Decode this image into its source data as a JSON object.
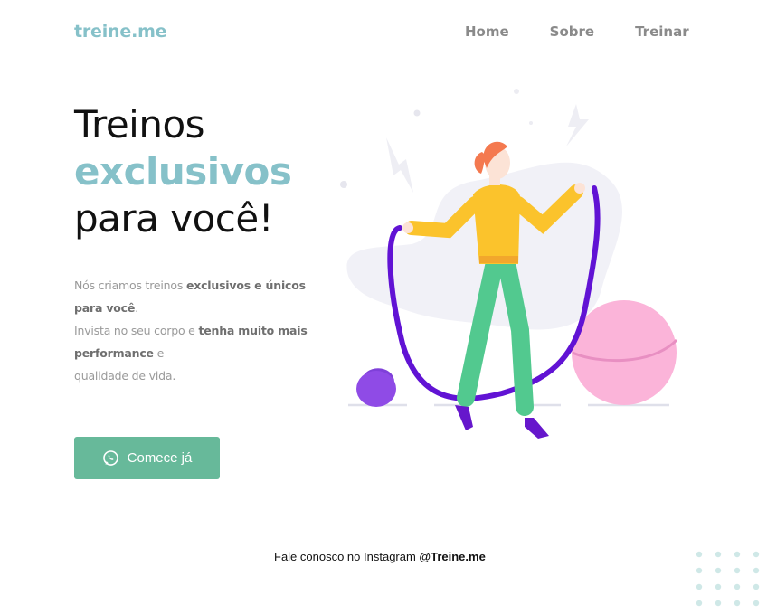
{
  "header": {
    "logo": "treine.me",
    "nav": [
      {
        "label": "Home"
      },
      {
        "label": "Sobre"
      },
      {
        "label": "Treinar"
      }
    ]
  },
  "hero": {
    "title_line1": "Treinos",
    "title_line2": "exclusivos",
    "title_line3": "para você!",
    "description": {
      "p1_a": "Nós criamos treinos ",
      "p1_b": "exclusivos e únicos para você",
      "p1_c": ".",
      "p2_a": "Invista no seu corpo e ",
      "p2_b": "tenha muito mais performance",
      "p2_c": " e",
      "p3": "qualidade de vida."
    },
    "cta_label": "Comece já",
    "cta_icon": "whatsapp-icon"
  },
  "footer": {
    "text": "Fale conosco no Instagram ",
    "handle": "@Treine.me"
  },
  "colors": {
    "accent": "#86c1c9",
    "button": "#67b99a",
    "nav_text": "#8a8a8a",
    "body_text": "#9a9a9a"
  }
}
